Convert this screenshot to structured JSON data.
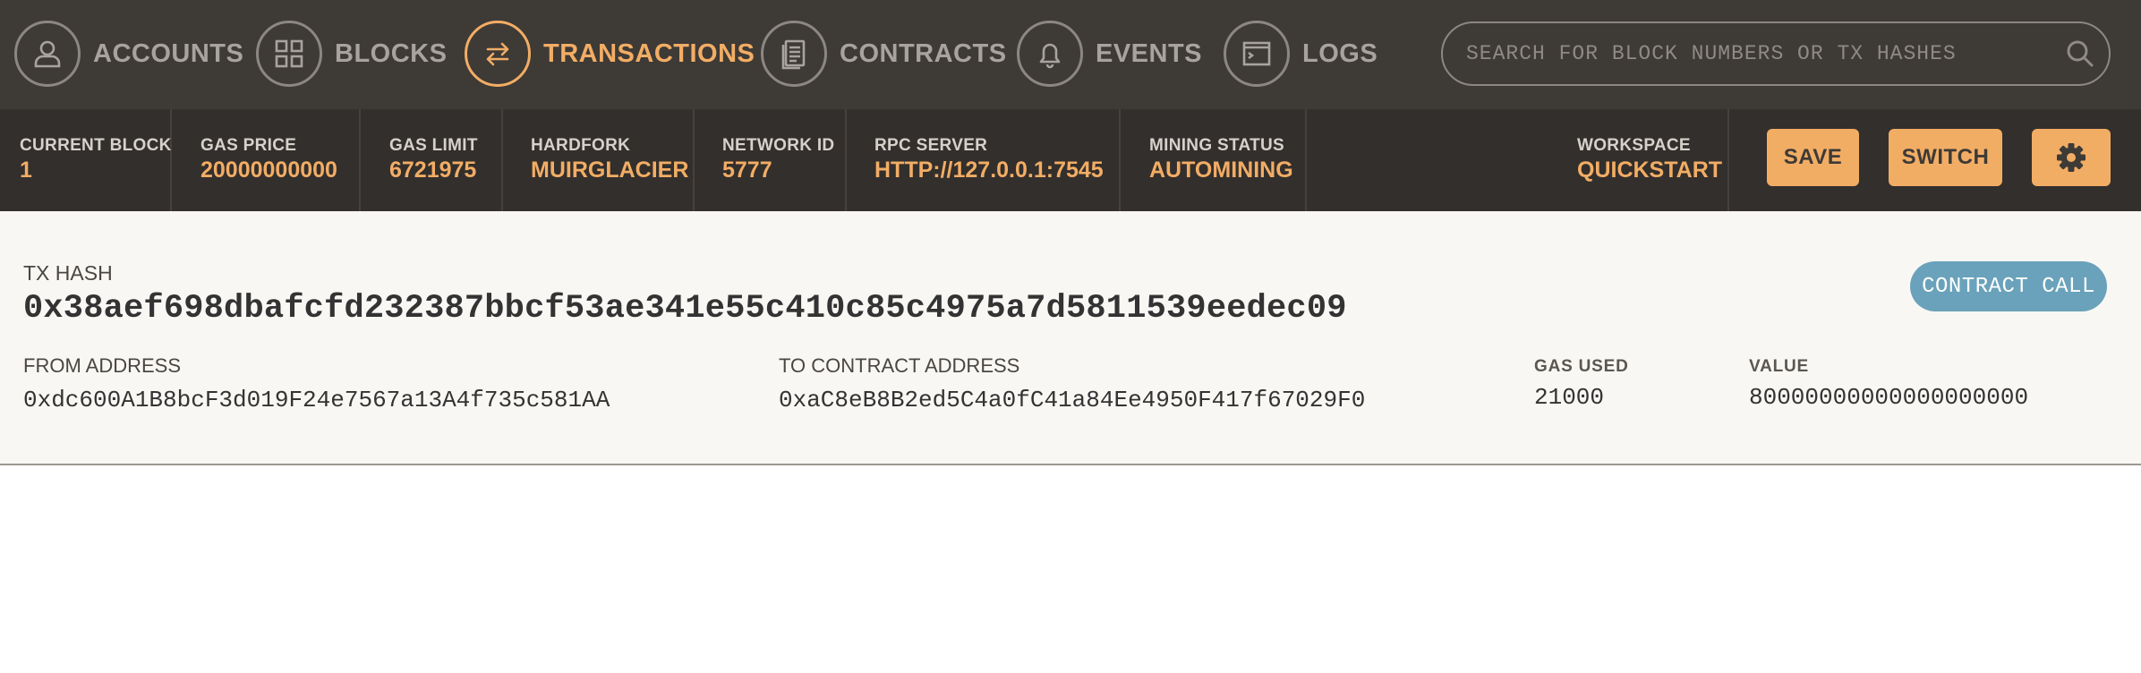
{
  "nav": {
    "items": [
      {
        "label": "ACCOUNTS",
        "icon": "user-icon"
      },
      {
        "label": "BLOCKS",
        "icon": "grid-icon"
      },
      {
        "label": "TRANSACTIONS",
        "icon": "swap-arrows-icon",
        "active": true
      },
      {
        "label": "CONTRACTS",
        "icon": "document-icon"
      },
      {
        "label": "EVENTS",
        "icon": "bell-icon"
      },
      {
        "label": "LOGS",
        "icon": "terminal-icon"
      }
    ],
    "search_placeholder": "SEARCH FOR BLOCK NUMBERS OR TX HASHES"
  },
  "status": {
    "current_block": {
      "label": "CURRENT BLOCK",
      "value": "1"
    },
    "gas_price": {
      "label": "GAS PRICE",
      "value": "20000000000"
    },
    "gas_limit": {
      "label": "GAS LIMIT",
      "value": "6721975"
    },
    "hardfork": {
      "label": "HARDFORK",
      "value": "MUIRGLACIER"
    },
    "network_id": {
      "label": "NETWORK ID",
      "value": "5777"
    },
    "rpc_server": {
      "label": "RPC SERVER",
      "value": "HTTP://127.0.0.1:7545"
    },
    "mining_status": {
      "label": "MINING STATUS",
      "value": "AUTOMINING"
    },
    "workspace": {
      "label": "WORKSPACE",
      "value": "QUICKSTART"
    },
    "save_label": "SAVE",
    "switch_label": "SWITCH"
  },
  "transaction": {
    "hash_label": "TX HASH",
    "hash": "0x38aef698dbafcfd232387bbcf53ae341e55c410c85c4975a7d5811539eedec09",
    "type_badge": "CONTRACT CALL",
    "from_label": "FROM ADDRESS",
    "from": "0xdc600A1B8bcF3d019F24e7567a13A4f735c581AA",
    "to_label": "TO CONTRACT ADDRESS",
    "to": "0xaC8eB8B2ed5C4a0fC41a84Ee4950F417f67029F0",
    "gas_used_label": "GAS USED",
    "gas_used": "21000",
    "value_label": "VALUE",
    "value": "80000000000000000000"
  },
  "colors": {
    "accent": "#f2ad65",
    "nav_bg": "#3e3a36",
    "status_bg": "#332f2c",
    "badge": "#6aa2bb"
  }
}
